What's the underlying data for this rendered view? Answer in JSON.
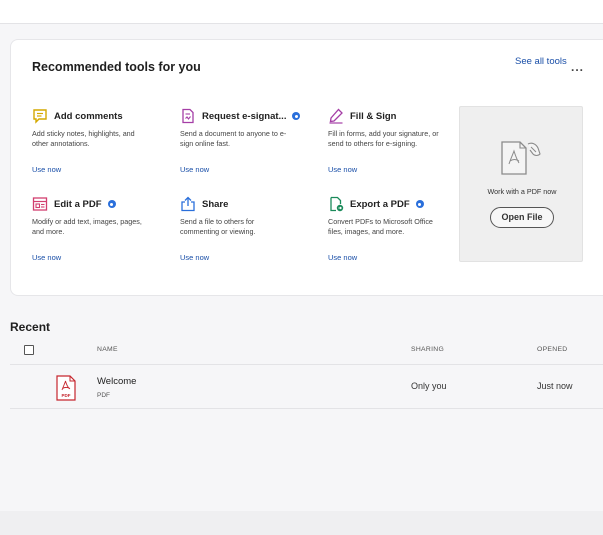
{
  "tools_card": {
    "title": "Recommended tools for you",
    "see_all": "See all tools",
    "more": "...",
    "tools": [
      {
        "name": "Add comments",
        "desc": "Add sticky notes, highlights, and other annotations.",
        "link": "Use now",
        "icon": "comment-icon",
        "color": "#d4a900"
      },
      {
        "name": "Request e-signat...",
        "desc": "Send a document to anyone to e-sign online fast.",
        "link": "Use now",
        "icon": "request-signature-icon",
        "color": "#a53ea6"
      },
      {
        "name": "Fill & Sign",
        "desc": "Fill in forms, add your signature, or send to others for e-signing.",
        "link": "Use now",
        "icon": "pen-sign-icon",
        "color": "#a53ea6"
      },
      {
        "name": "Edit a PDF",
        "desc": "Modify or add text, images, pages, and more.",
        "link": "Use now",
        "icon": "edit-pdf-icon",
        "color": "#d23f6f"
      },
      {
        "name": "Share",
        "desc": "Send a file to others for commenting or viewing.",
        "link": "Use now",
        "icon": "share-icon",
        "color": "#2a6fdb"
      },
      {
        "name": "Export a PDF",
        "desc": "Convert PDFs to Microsoft Office files, images, and more.",
        "link": "Use now",
        "icon": "export-pdf-icon",
        "color": "#1a8a5a"
      }
    ],
    "open_panel": {
      "text": "Work with a PDF now",
      "button": "Open File"
    }
  },
  "recent": {
    "title": "Recent",
    "columns": [
      "NAME",
      "SHARING",
      "OPENED"
    ],
    "rows": [
      {
        "name": "Welcome",
        "type": "PDF",
        "sharing": "Only you",
        "opened": "Just now"
      }
    ]
  },
  "colors": {
    "link": "#1a4fa8",
    "pdf_red": "#c6262e",
    "badge_blue": "#2a6fdb"
  }
}
